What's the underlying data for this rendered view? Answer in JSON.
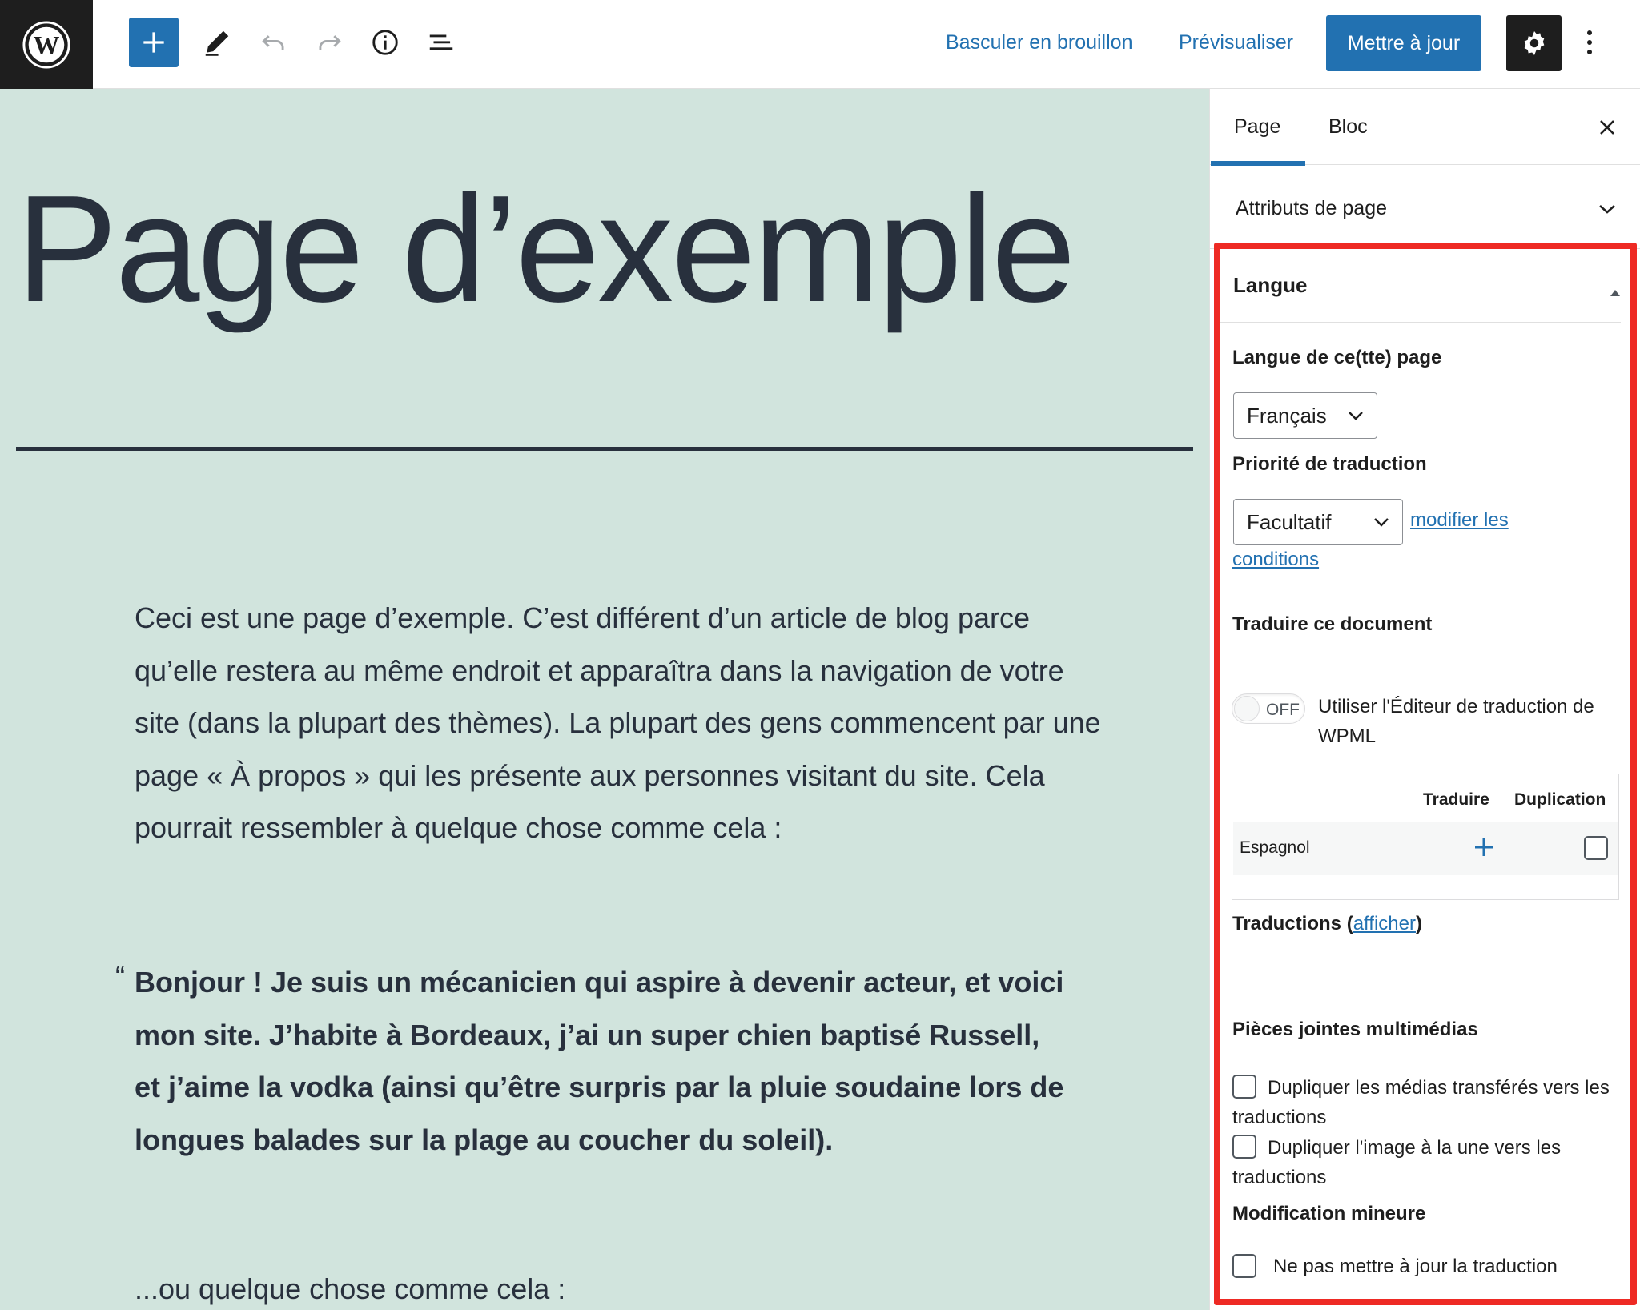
{
  "toolbar": {
    "draft_label": "Basculer en brouillon",
    "preview_label": "Prévisualiser",
    "update_label": "Mettre à jour"
  },
  "editor": {
    "title": "Page d’exemple",
    "paragraph": "Ceci est une page d’exemple. C’est différent d’un article de blog parce qu’elle restera au même endroit et apparaîtra dans la navigation de votre site (dans la plupart des thèmes). La plupart des gens commencent par une page « À propos » qui les présente aux personnes visitant du site. Cela pourrait ressembler à quelque chose comme cela :",
    "quote_mark": "“",
    "quote": "Bonjour ! Je suis un mécanicien qui aspire à devenir acteur, et voici mon site. J’habite à Bordeaux, j’ai un super chien baptisé Russell, et j’aime la vodka (ainsi qu’être surpris par la pluie soudaine lors de longues balades sur la plage au coucher du soleil).",
    "after_quote": "...ou quelque chose comme cela :",
    "background_color": "#d1e4dd"
  },
  "sidebar": {
    "tabs": [
      {
        "label": "Page",
        "active": true
      },
      {
        "label": "Bloc",
        "active": false
      }
    ],
    "page_attributes": "Attributs de page",
    "language_panel": {
      "title": "Langue",
      "page_language_label": "Langue de ce(tte) page",
      "page_language_value": "Français",
      "priority_label": "Priorité de traduction",
      "priority_value": "Facultatif",
      "modify_link_1": "modifier les",
      "modify_link_2": "conditions",
      "translate_doc_label": "Traduire ce document",
      "toggle_state": "OFF",
      "toggle_text": "Utiliser l'Éditeur de traduction de WPML",
      "table_headers": {
        "translate": "Traduire",
        "duplicate": "Duplication"
      },
      "table_rows": [
        {
          "language": "Espagnol"
        }
      ],
      "translations_label": "Traductions (",
      "translations_link": "afficher",
      "translations_close": ")",
      "media_label": "Pièces jointes multimédias",
      "media_option_1": "Dupliquer les médias transférés vers les traductions",
      "media_option_2": "Dupliquer l'image à la une vers les traductions",
      "minor_label": "Modification mineure",
      "minor_option": "Ne pas mettre à jour la traduction"
    }
  },
  "colors": {
    "accent": "#2271b1",
    "highlight": "#ee2a24",
    "dark": "#1e1e1e"
  }
}
